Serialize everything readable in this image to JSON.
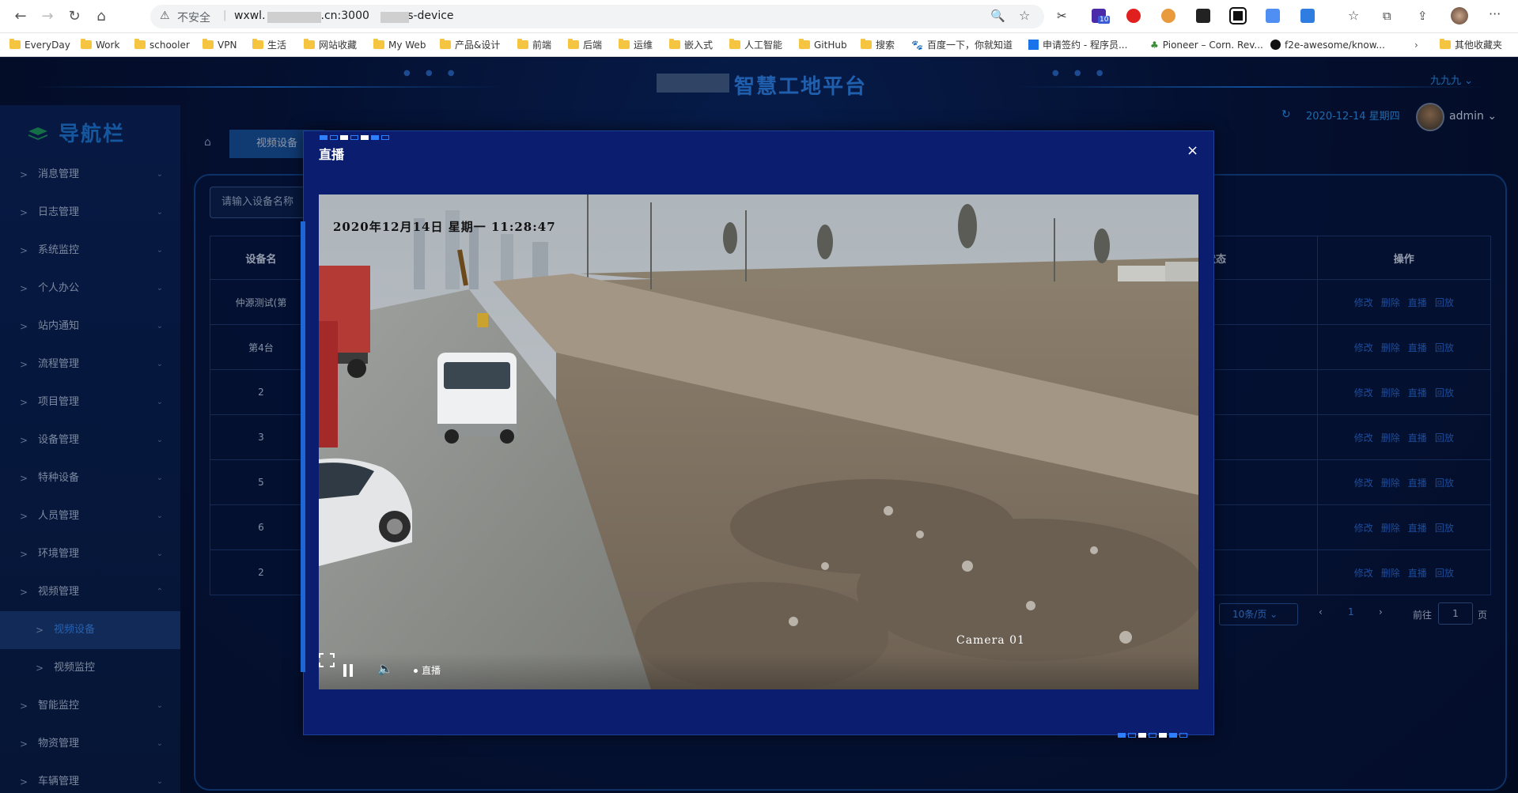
{
  "browser": {
    "insecure_label": "不安全",
    "url_part1": "wxwl.",
    "url_part2": ".cn:3000",
    "url_part3": "vs-device",
    "bookmarks": [
      "EveryDay",
      "Work",
      "schooler",
      "VPN",
      "生活",
      "网站收藏",
      "My Web",
      "产品&设计",
      "前端",
      "后端",
      "运维",
      "嵌入式",
      "人工智能",
      "GitHub",
      "搜索",
      "百度一下，你就知道",
      "申请签约 - 程序员...",
      "Pioneer – Corn. Rev...",
      "f2e-awesome/know...",
      "其他收藏夹"
    ],
    "ext_badge": "10"
  },
  "header": {
    "title": "智慧工地平台",
    "user_name": "九九九",
    "date": "2020-12-14 星期四",
    "admin": "admin"
  },
  "sidebar": {
    "title": "导航栏",
    "items": [
      {
        "label": "消息管理"
      },
      {
        "label": "日志管理"
      },
      {
        "label": "系统监控"
      },
      {
        "label": "个人办公"
      },
      {
        "label": "站内通知"
      },
      {
        "label": "流程管理"
      },
      {
        "label": "项目管理"
      },
      {
        "label": "设备管理"
      },
      {
        "label": "特种设备"
      },
      {
        "label": "人员管理"
      },
      {
        "label": "环境管理"
      },
      {
        "label": "视频管理"
      },
      {
        "label": "视频设备"
      },
      {
        "label": "视频监控"
      },
      {
        "label": "智能监控"
      },
      {
        "label": "物资管理"
      },
      {
        "label": "车辆管理"
      }
    ]
  },
  "tab": {
    "label": "视频设备"
  },
  "search": {
    "placeholder": "请输入设备名称"
  },
  "table": {
    "left_header": "设备名",
    "left_rows": [
      "仲源测试(第",
      "第4台",
      "2",
      "3",
      "5",
      "6",
      "2"
    ],
    "status_header": "状态",
    "op_header": "操作",
    "ops": [
      "修改",
      "删除",
      "直播",
      "回放"
    ],
    "row_count": 7
  },
  "pagination": {
    "page_size": "10条/页",
    "current": "1",
    "goto_label": "前往",
    "goto_value": "1",
    "page_suffix": "页"
  },
  "modal": {
    "title": "直播",
    "close": "×",
    "timestamp": "2020年12月14日 星期一 11:28:47",
    "camera": "Camera 01",
    "live_label": "直播"
  }
}
